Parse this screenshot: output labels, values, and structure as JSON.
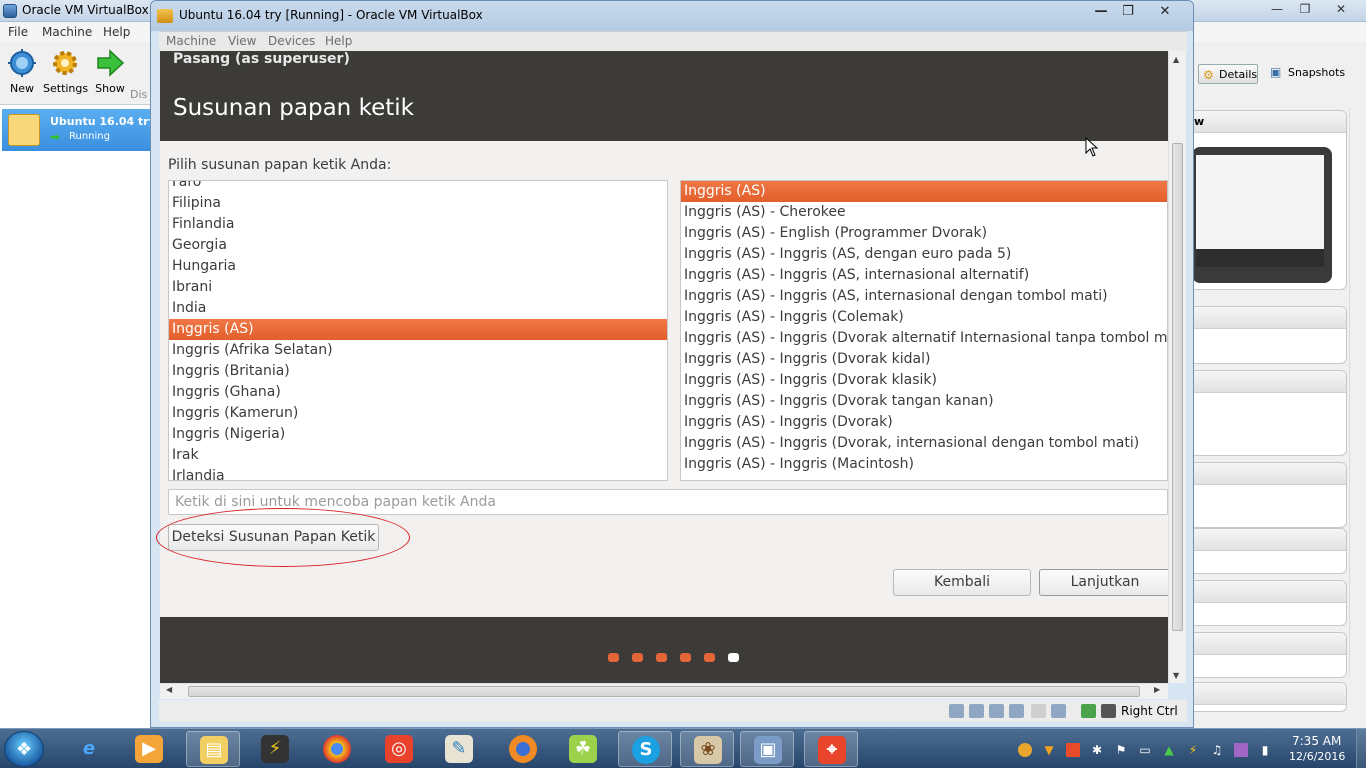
{
  "manager": {
    "title": "Oracle VM VirtualBox M",
    "menu": [
      "File",
      "Machine",
      "Help"
    ],
    "toolbar": [
      {
        "label": "New",
        "icon": "new-icon"
      },
      {
        "label": "Settings",
        "icon": "gear-icon"
      },
      {
        "label": "Show",
        "icon": "green-arrow-icon"
      },
      {
        "label": "Dis",
        "icon": "discard-icon"
      }
    ],
    "vm": {
      "name": "Ubuntu 16.04 try",
      "state": "Running"
    },
    "right": {
      "details": "Details",
      "snapshots": "Snapshots",
      "preview_label": "w"
    }
  },
  "vmwindow": {
    "title": "Ubuntu 16.04 try [Running] - Oracle VM VirtualBox",
    "menu": [
      "Machine",
      "View",
      "Devices",
      "Help"
    ],
    "host_key": "Right Ctrl"
  },
  "installer": {
    "title": "Pasang (as superuser)",
    "page_title": "Susunan papan ketik",
    "prompt": "Pilih susunan papan ketik Anda:",
    "layouts": [
      "Faro",
      "Filipina",
      "Finlandia",
      "Georgia",
      "Hungaria",
      "Ibrani",
      "India",
      "Inggris (AS)",
      "Inggris (Afrika Selatan)",
      "Inggris (Britania)",
      "Inggris (Ghana)",
      "Inggris (Kamerun)",
      "Inggris (Nigeria)",
      "Irak",
      "Irlandia"
    ],
    "layout_selected": "Inggris (AS)",
    "variants": [
      "Inggris (AS)",
      "Inggris (AS) - Cherokee",
      "Inggris (AS) - English (Programmer Dvorak)",
      "Inggris (AS) - Inggris (AS, dengan euro pada 5)",
      "Inggris (AS) - Inggris (AS, internasional alternatif)",
      "Inggris (AS) - Inggris (AS, internasional dengan tombol mati)",
      "Inggris (AS) - Inggris (Colemak)",
      "Inggris (AS) - Inggris (Dvorak alternatif Internasional tanpa tombol mati)",
      "Inggris (AS) - Inggris (Dvorak kidal)",
      "Inggris (AS) - Inggris (Dvorak klasik)",
      "Inggris (AS) - Inggris (Dvorak tangan kanan)",
      "Inggris (AS) - Inggris (Dvorak)",
      "Inggris (AS) - Inggris (Dvorak, internasional dengan tombol mati)",
      "Inggris (AS) - Inggris (Macintosh)"
    ],
    "variant_selected": "Inggris (AS)",
    "test_placeholder": "Ketik di sini untuk mencoba papan ketik Anda",
    "detect_button": "Deteksi Susunan Papan Ketik",
    "back_button": "Kembali",
    "next_button": "Lanjutkan",
    "progress": {
      "total_steps": 6,
      "current_step": 6
    }
  },
  "taskbar": {
    "time": "7:35 AM",
    "date": "12/6/2016",
    "apps": [
      "internet-explorer-icon",
      "media-player-icon",
      "file-explorer-icon",
      "winamp-icon",
      "chrome-icon",
      "app-icon",
      "paint-icon",
      "firefox-icon",
      "green-app-icon",
      "skype-icon",
      "paint-palette-icon",
      "virtualbox-icon",
      "crop-tool-icon"
    ]
  },
  "colors": {
    "accent": "#e25f2b",
    "guest_header": "#3c3b37",
    "selection_text": "#ffffff"
  }
}
